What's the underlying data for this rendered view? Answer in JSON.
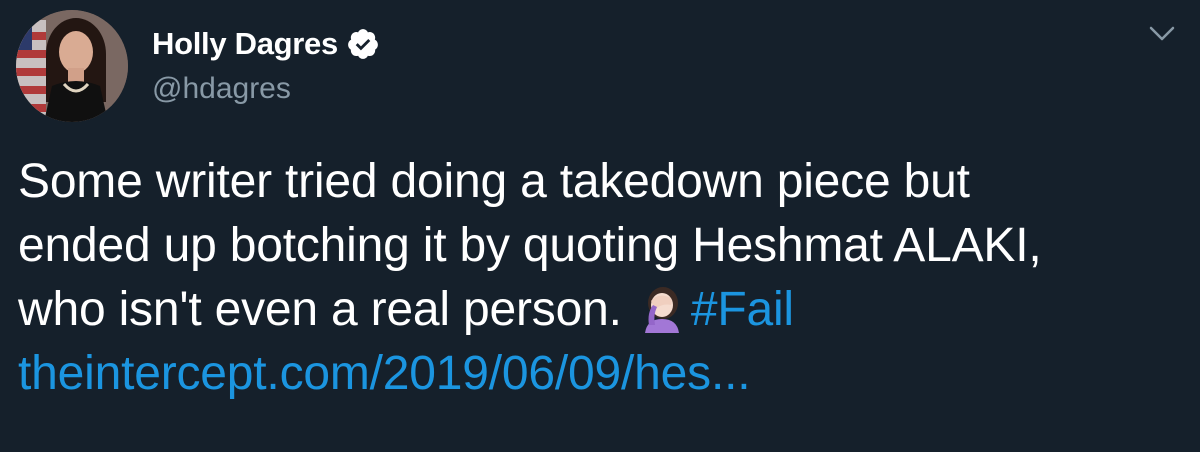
{
  "author": {
    "display_name": "Holly Dagres",
    "handle": "@hdagres",
    "verified": true,
    "avatar_icon": "profile-photo"
  },
  "tweet": {
    "line1": "Some writer tried doing a takedown piece but",
    "line2": "ended up botching it by quoting Heshmat ALAKI,",
    "line3_text": "who isn't even a real person.",
    "emoji": "person-facepalming-emoji",
    "hashtag": "#Fail",
    "link": "theintercept.com/2019/06/09/hes..."
  },
  "menu": {
    "icon": "chevron-down-icon"
  },
  "colors": {
    "background": "#15202b",
    "text": "#ffffff",
    "secondary": "#8899a6",
    "accent": "#1b95e0"
  }
}
